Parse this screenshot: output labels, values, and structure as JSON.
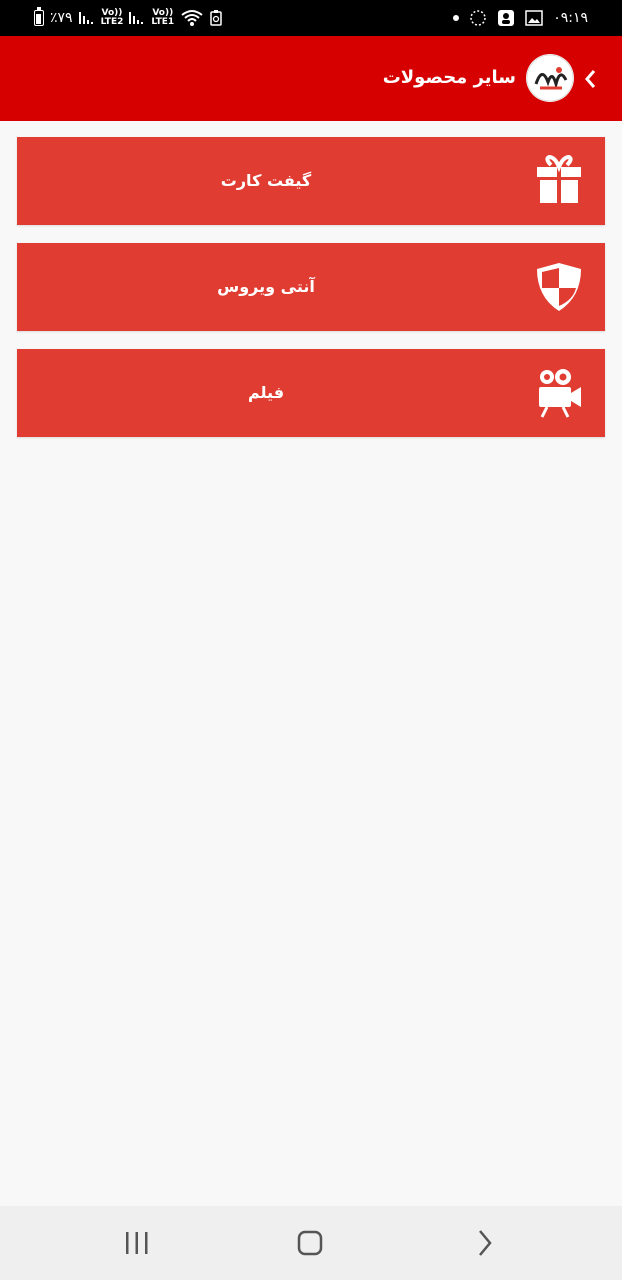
{
  "status_bar": {
    "time": "۰۹:۱۹",
    "battery": "٪۷۹",
    "sim2_label": "LTE2",
    "sim1_label": "LTE1",
    "volte": "Vo))"
  },
  "app_bar": {
    "title": "سایر محصولات",
    "back_icon": "chevron-left-icon",
    "logo_icon": "app-logo"
  },
  "items": [
    {
      "label": "گیفت کارت",
      "icon": "gift-icon"
    },
    {
      "label": "آنتی ویروس",
      "icon": "shield-icon"
    },
    {
      "label": "فیلم",
      "icon": "video-camera-icon"
    }
  ],
  "nav_bar": {
    "recents_icon": "recents-icon",
    "home_icon": "home-icon",
    "back_icon": "back-icon"
  },
  "colors": {
    "app_bar": "#d60000",
    "item_bg": "#e03c31",
    "background": "#f8f8f8"
  }
}
